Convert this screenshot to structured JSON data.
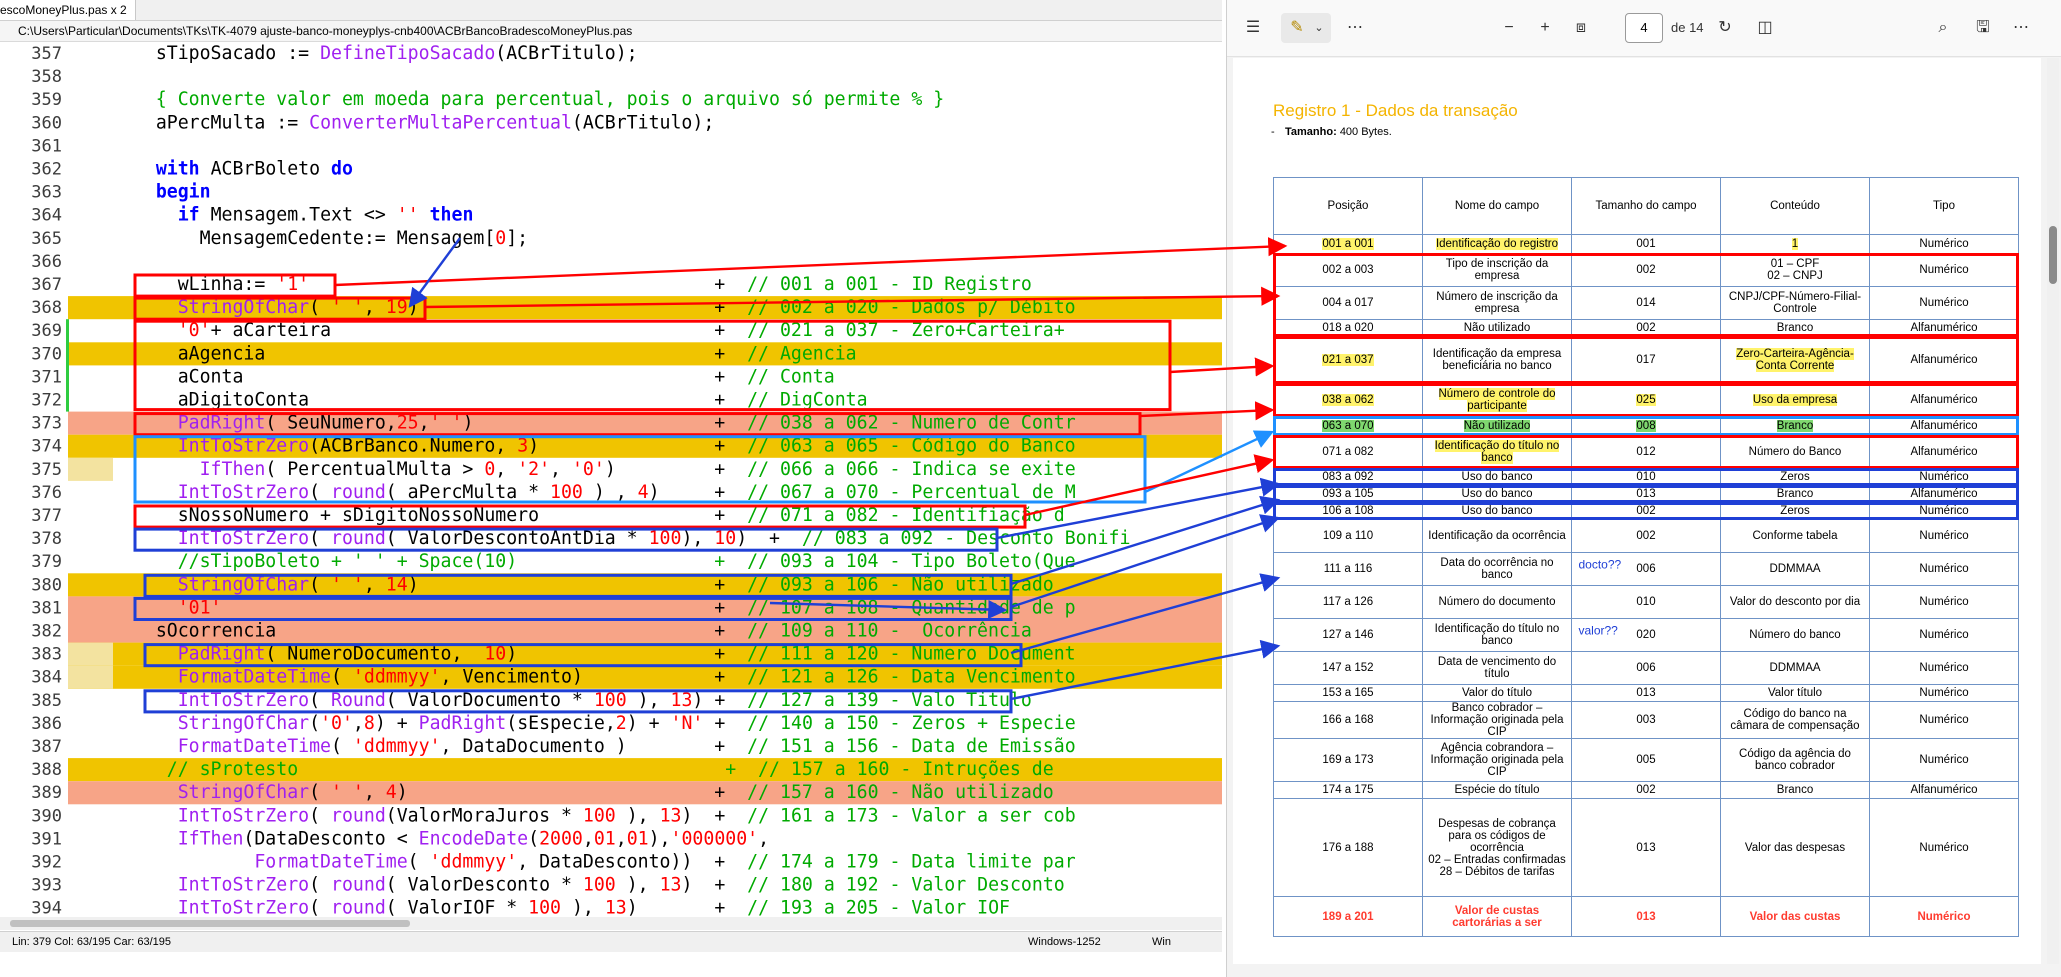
{
  "editor": {
    "tab_label": "escoMoneyPlus.pas x 2",
    "file_path": "C:\\Users\\Particular\\Documents\\TKs\\TK-4079 ajuste-banco-moneyplys-cnb400\\ACBrBancoBradescoMoneyPlus.pas",
    "lines": [
      {
        "n": "357",
        "t": "    sTipoSacado := DefineTipoSacado(ACBrTitulo);"
      },
      {
        "n": "358",
        "t": ""
      },
      {
        "n": "359",
        "t": "    { Converte valor em moeda para percentual, pois o arquivo só permite % }"
      },
      {
        "n": "360",
        "t": "    aPercMulta := ConverterMultaPercentual(ACBrTitulo);"
      },
      {
        "n": "361",
        "t": ""
      },
      {
        "n": "362",
        "t": "    with ACBrBoleto do"
      },
      {
        "n": "363",
        "t": "    begin"
      },
      {
        "n": "364",
        "t": "      if Mensagem.Text <> '' then"
      },
      {
        "n": "365",
        "t": "        MensagemCedente:= Mensagem[0];"
      },
      {
        "n": "366",
        "t": ""
      },
      {
        "n": "367",
        "t": "      wLinha:= '1'                                     +  // 001 a 001 - ID Registro"
      },
      {
        "n": "368",
        "t": "      StringOfChar( ' ', 19)                           +  // 002 a 020 - Dados p/ Débito"
      },
      {
        "n": "369",
        "t": "      '0'+ aCarteira                                   +  // 021 a 037 - Zero+Carteira+"
      },
      {
        "n": "370",
        "t": "      aAgencia                                         +  // Agencia"
      },
      {
        "n": "371",
        "t": "      aConta                                           +  // Conta"
      },
      {
        "n": "372",
        "t": "      aDigitoConta                                     +  // DigConta"
      },
      {
        "n": "373",
        "t": "      PadRight( SeuNumero,25,' ')                      +  // 038 a 062 - Numero de Contr"
      },
      {
        "n": "374",
        "t": "      IntToStrZero(ACBrBanco.Numero, 3)                +  // 063 a 065 - Código do Banco"
      },
      {
        "n": "375",
        "t": "        IfThen( PercentualMulta > 0, '2', '0')         +  // 066 a 066 - Indica se exite"
      },
      {
        "n": "376",
        "t": "      IntToStrZero( round( aPercMulta * 100 ) , 4)     +  // 067 a 070 - Percentual de M"
      },
      {
        "n": "377",
        "t": "      sNossoNumero + sDigitoNossoNumero                +  // 071 a 082 - Identifiação d"
      },
      {
        "n": "378",
        "t": "      IntToStrZero( round( ValorDescontoAntDia * 100), 10)  +  // 083 a 092 - Desconto Bonifi"
      },
      {
        "n": "379",
        "t": "      //sTipoBoleto + ' ' + Space(10)                  +  // 093 a 104 - Tipo Boleto(Que"
      },
      {
        "n": "380",
        "t": "      StringOfChar( ' ', 14)                           +  // 093 a 106 - Não utilizado"
      },
      {
        "n": "381",
        "t": "      '01'                                             +  // 107 a 108 - Quantidade de p"
      },
      {
        "n": "382",
        "t": "    sOcorrencia                                        +  // 109 a 110 -  Ocorrência"
      },
      {
        "n": "383",
        "t": "      PadRight( NumeroDocumento,  10)                  +  // 111 a 120 - Numero Document"
      },
      {
        "n": "384",
        "t": "      FormatDateTime( 'ddmmyy', Vencimento)            +  // 121 a 126 - Data Vencimento"
      },
      {
        "n": "385",
        "t": "      IntToStrZero( Round( ValorDocumento * 100 ), 13) +  // 127 a 139 - Valo Titulo"
      },
      {
        "n": "386",
        "t": "      StringOfChar('0',8) + PadRight(sEspecie,2) + 'N' +  // 140 a 150 - Zeros + Especie"
      },
      {
        "n": "387",
        "t": "      FormatDateTime( 'ddmmyy', DataDocumento )        +  // 151 a 156 - Data de Emissão"
      },
      {
        "n": "388",
        "t": "     // sProtesto                                       +  // 157 a 160 - Intruções de"
      },
      {
        "n": "389",
        "t": "      StringOfChar( ' ', 4)                            +  // 157 a 160 - Não utilizado"
      },
      {
        "n": "390",
        "t": "      IntToStrZero( round(ValorMoraJuros * 100 ), 13)  +  // 161 a 173 - Valor a ser cob"
      },
      {
        "n": "391",
        "t": "      IfThen(DataDesconto < EncodeDate(2000,01,01),'000000',"
      },
      {
        "n": "392",
        "t": "             FormatDateTime( 'ddmmyy', DataDesconto))  +  // 174 a 179 - Data limite par"
      },
      {
        "n": "393",
        "t": "      IntToStrZero( round( ValorDesconto * 100 ), 13)  +  // 180 a 192 - Valor Desconto"
      },
      {
        "n": "394",
        "t": "      IntToStrZero( round( ValorIOF * 100 ), 13)       +  // 193 a 205 - Valor IOF"
      }
    ],
    "status": {
      "position": "Lin: 379  Col: 63/195  Car: 63/195",
      "encoding": "Windows-1252",
      "eol": "Win"
    },
    "colors": {
      "orange": "#f0c400",
      "salmon": "#f7a487",
      "keyword": "#0000ff",
      "func": "#a020f0",
      "string": "#ff0000",
      "comment": "#00aa00",
      "red_box": "#ff0000",
      "blue_box": "#1f3fd6",
      "cyan_box": "#1e90ff"
    }
  },
  "pdf": {
    "toolbar": {
      "page_current": "4",
      "page_total": "de 14",
      "icons": [
        "contents-icon",
        "highlight-icon",
        "chevron-down-icon",
        "more-icon",
        "zoom-out-icon",
        "zoom-in-icon",
        "fit-page-icon",
        "rotate-icon",
        "two-page-icon",
        "search-icon",
        "save-icon",
        "more-icon"
      ]
    },
    "section_title": "Registro 1 - Dados da transação",
    "size_label": "Tamanho:",
    "size_value": "400 Bytes.",
    "bullet": "-",
    "table_headers": [
      "Posição",
      "Nome do campo",
      "Tamanho do campo",
      "Conteúdo",
      "Tipo"
    ],
    "rows": [
      [
        "001 a 001",
        "Identificação do registro",
        "001",
        "1",
        "Numérico"
      ],
      [
        "002 a 003",
        "Tipo de inscrição da empresa",
        "002",
        "01 – CPF\n02 – CNPJ",
        "Numérico"
      ],
      [
        "004 a 017",
        "Número de inscrição da empresa",
        "014",
        "CNPJ/CPF-Número-Filial-Controle",
        "Numérico"
      ],
      [
        "018 a 020",
        "Não utilizado",
        "002",
        "Branco",
        "Alfanumérico"
      ],
      [
        "021 a 037",
        "Identificação da empresa beneficiária no banco",
        "017",
        "Zero-Carteira-Agência-Conta Corrente",
        "Alfanumérico"
      ],
      [
        "038 a 062",
        "Número de controle do participante",
        "025",
        "Uso da empresa",
        "Alfanumérico"
      ],
      [
        "063 a 070",
        "Não utilizado",
        "008",
        "Branco",
        "Alfanumérico"
      ],
      [
        "071 a 082",
        "Identificação do título no banco",
        "012",
        "Número do Banco",
        "Alfanumérico"
      ],
      [
        "083 a 092",
        "Uso do banco",
        "010",
        "Zeros",
        "Numérico"
      ],
      [
        "093 a 105",
        "Uso do banco",
        "013",
        "Branco",
        "Alfanumérico"
      ],
      [
        "106 a 108",
        "Uso do banco",
        "002",
        "Zeros",
        "Numérico"
      ],
      [
        "109 a 110",
        "Identificação da ocorrência",
        "002",
        "Conforme tabela",
        "Numérico"
      ],
      [
        "111 a 116",
        "Data do ocorrência no banco",
        "006",
        "DDMMAA",
        "Numérico"
      ],
      [
        "117 a 126",
        "Número do documento",
        "010",
        "Valor do desconto por dia",
        "Numérico"
      ],
      [
        "127 a 146",
        "Identificação do título no banco",
        "020",
        "Número do banco",
        "Numérico"
      ],
      [
        "147 a 152",
        "Data de vencimento do título",
        "006",
        "DDMMAA",
        "Numérico"
      ],
      [
        "153 a 165",
        "Valor do título",
        "013",
        "Valor título",
        "Numérico"
      ],
      [
        "166 a 168",
        "Banco cobrador – Informação originada pela CIP",
        "003",
        "Código do banco na câmara de compensação",
        "Numérico"
      ],
      [
        "169 a 173",
        "Agência cobrandora – Informação originada pela CIP",
        "005",
        "Código da agência do banco cobrador",
        "Numérico"
      ],
      [
        "174 a 175",
        "Espécie do título",
        "002",
        "Branco",
        "Alfanumérico"
      ],
      [
        "176 a 188",
        "Despesas de cobrança para os códigos de ocorrência\n02 – Entradas confirmadas\n28 – Débitos de tarifas",
        "013",
        "Valor das despesas",
        "Numérico"
      ],
      [
        "189 a 201",
        "Valor de custas cartorárias a ser",
        "013",
        "Valor das custas",
        "Numérico"
      ]
    ],
    "annotations": {
      "docto": "docto??",
      "valor": "valor??"
    }
  }
}
